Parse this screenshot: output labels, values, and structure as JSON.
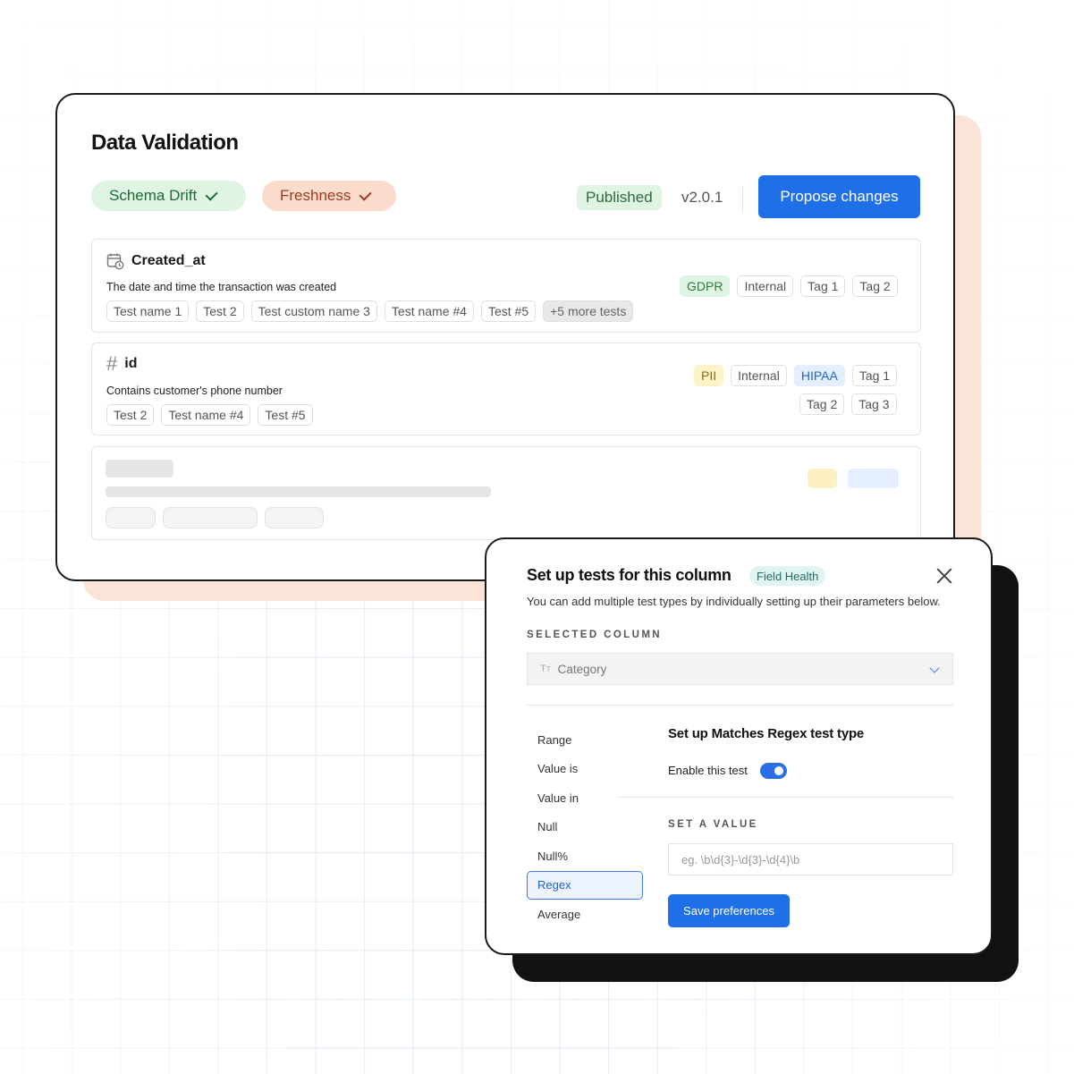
{
  "main_card": {
    "title": "Data Validation",
    "monitor_pills": [
      {
        "label": "Schema Drift",
        "color": "#dff4e3"
      },
      {
        "label": "Freshness",
        "color": "#fbdccc"
      }
    ],
    "status": "Published",
    "version": "v2.0.1",
    "propose_label": "Propose changes"
  },
  "columns": [
    {
      "icon": "calendar-clock-icon",
      "name": "Created_at",
      "description": "The date and time the transaction was created",
      "tests": [
        "Test name 1",
        "Test 2",
        "Test custom name 3",
        "Test name #4",
        "Test #5"
      ],
      "more_tests": "+5 more tests",
      "tags": [
        "GDPR",
        "Internal",
        "Tag 1",
        "Tag 2"
      ]
    },
    {
      "icon": "hash-icon",
      "name": "id",
      "description": "Contains customer's phone number",
      "tests": [
        "Test 2",
        "Test name #4",
        "Test #5"
      ],
      "tags_row1": [
        "PII",
        "Internal",
        "HIPAA",
        "Tag 1"
      ],
      "tags_row2": [
        "Tag 2",
        "Tag 3"
      ]
    }
  ],
  "modal": {
    "title": "Set up tests for this column",
    "badge": "Field Health",
    "subtitle": "You can add multiple test types by individually setting up their parameters below.",
    "selected_column_label": "SELECTED COLUMN",
    "selected_column_value": "Category",
    "test_types": [
      "Range",
      "Value is",
      "Value in",
      "Null",
      "Null%",
      "Regex",
      "Average"
    ],
    "active_test": "Regex",
    "setup_title": "Set up Matches Regex test type",
    "enable_label": "Enable this test",
    "enabled": true,
    "set_value_label": "SET A VALUE",
    "value_placeholder": "eg. \\b\\d{3}-\\d{3}-\\d{4}\\b",
    "save_label": "Save preferences"
  },
  "colors": {
    "primary": "#1f6fe8",
    "peach": "#fbe3d8",
    "green_tag": "#dff4e3",
    "yellow_tag": "#fdf3c8",
    "blue_tag": "#e3efff"
  }
}
